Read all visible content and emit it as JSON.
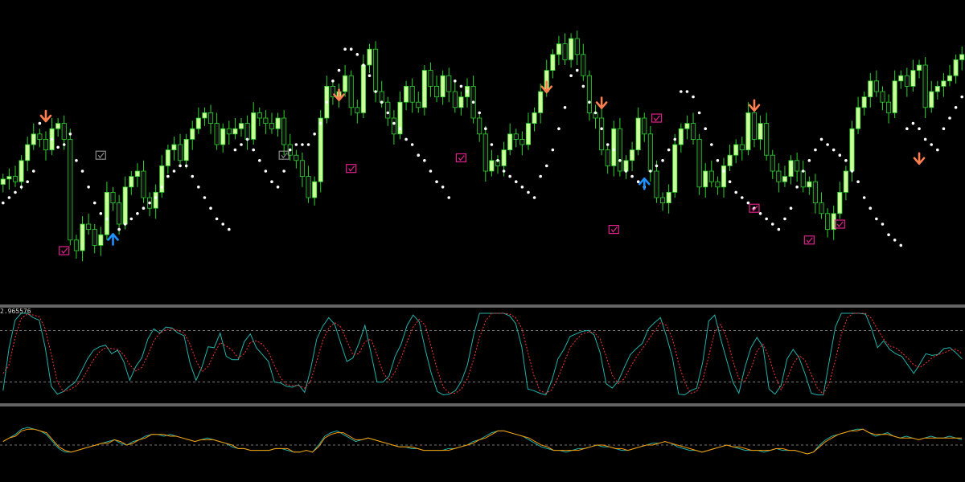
{
  "colors": {
    "background": "#000000",
    "bull_candle": "#ccff99",
    "bear_candle": "#111111",
    "candle_wick": "#2bd42b",
    "sar_dot": "#ffffff",
    "arrow_down": "#ff7f50",
    "arrow_up": "#1e90ff",
    "check_box_pink": "#e0208c",
    "check_box_gray": "#8a8a8a",
    "separator": "#c8c8c8",
    "level_line": "#9a9a9a",
    "stoch_main": "#20b2aa",
    "stoch_signal": "#ff3333",
    "osc_main": "#20b2aa",
    "osc_signal": "#ff9900"
  },
  "panel2_label": "2.965576",
  "chart_data": [
    {
      "type": "candlestick",
      "panel": "price",
      "ylim": [
        0,
        100
      ],
      "closes": [
        37,
        38,
        36,
        44,
        50,
        54,
        52,
        48,
        56,
        58,
        52,
        14,
        10,
        20,
        18,
        12,
        16,
        32,
        28,
        20,
        34,
        38,
        40,
        30,
        26,
        32,
        42,
        48,
        50,
        44,
        52,
        56,
        60,
        62,
        58,
        50,
        56,
        54,
        56,
        58,
        52,
        62,
        60,
        58,
        56,
        60,
        50,
        46,
        44,
        38,
        30,
        36,
        60,
        72,
        68,
        70,
        76,
        64,
        62,
        80,
        86,
        70,
        66,
        60,
        54,
        66,
        72,
        66,
        64,
        78,
        72,
        68,
        76,
        70,
        64,
        68,
        72,
        60,
        54,
        40,
        44,
        42,
        48,
        54,
        52,
        50,
        58,
        62,
        70,
        78,
        84,
        88,
        82,
        90,
        84,
        76,
        62,
        60,
        48,
        42,
        56,
        40,
        44,
        48,
        60,
        54,
        40,
        30,
        28,
        32,
        50,
        56,
        58,
        52,
        34,
        40,
        36,
        34,
        42,
        46,
        50,
        48,
        62,
        52,
        58,
        46,
        40,
        36,
        38,
        44,
        40,
        34,
        36,
        28,
        24,
        18,
        24,
        32,
        40,
        56,
        64,
        68,
        74,
        70,
        66,
        62,
        74,
        76,
        72,
        78,
        80,
        64,
        70,
        72,
        74,
        76,
        82,
        84
      ]
    },
    {
      "type": "scatter",
      "panel": "price",
      "name": "",
      "x": [
        0,
        1,
        2,
        3,
        4,
        5,
        6,
        8,
        9,
        10,
        11,
        12,
        13,
        14,
        15,
        16,
        17,
        18,
        19,
        20,
        21,
        22,
        23,
        24,
        25,
        26,
        27,
        28,
        29,
        30,
        31,
        32,
        33,
        34,
        35,
        36,
        37,
        38,
        39,
        40,
        41,
        42,
        43,
        44,
        45,
        46,
        47,
        48,
        49,
        50,
        51,
        52,
        53,
        54,
        55,
        56,
        57,
        58,
        59,
        60,
        61,
        62,
        63,
        64,
        65,
        66,
        67,
        68,
        69,
        70,
        71,
        72,
        73,
        74,
        75,
        76,
        77,
        78,
        79,
        80,
        81,
        82,
        83,
        84,
        85,
        86,
        87,
        88,
        89,
        90,
        91,
        92,
        93,
        94,
        95,
        96,
        97,
        98,
        99,
        100,
        101,
        102,
        103,
        104,
        105,
        106,
        107,
        108,
        109,
        110,
        111,
        112,
        113,
        114,
        115,
        116,
        117,
        118,
        119,
        120,
        121,
        122,
        123,
        124,
        125,
        126,
        127,
        128,
        129,
        130,
        131,
        132,
        133,
        134,
        135,
        136,
        137,
        138,
        139,
        140,
        141,
        142,
        143,
        144,
        145,
        146,
        147,
        148,
        149,
        150,
        151,
        152,
        153,
        154,
        155,
        156,
        157,
        158
      ],
      "values": [
        28,
        30,
        32,
        34,
        36,
        40,
        58,
        52,
        49,
        50,
        54,
        44,
        40,
        34,
        28,
        24,
        22,
        16,
        18,
        20,
        22,
        24,
        26,
        28,
        30,
        34,
        38,
        40,
        42,
        42,
        38,
        34,
        30,
        26,
        22,
        20,
        18,
        48,
        50,
        52,
        48,
        44,
        40,
        36,
        34,
        40,
        48,
        50,
        50,
        50,
        54,
        58,
        66,
        74,
        78,
        86,
        86,
        84,
        80,
        76,
        70,
        66,
        62,
        58,
        56,
        52,
        50,
        46,
        44,
        40,
        36,
        34,
        30,
        74,
        72,
        70,
        66,
        62,
        56,
        50,
        44,
        40,
        38,
        36,
        34,
        32,
        30,
        38,
        42,
        48,
        56,
        64,
        76,
        78,
        72,
        66,
        62,
        56,
        50,
        48,
        44,
        40,
        38,
        36,
        34,
        40,
        42,
        44,
        48,
        52,
        70,
        70,
        68,
        62,
        56,
        50,
        44,
        40,
        36,
        32,
        30,
        28,
        26,
        24,
        22,
        20,
        18,
        22,
        26,
        34,
        40,
        44,
        48,
        52,
        50,
        48,
        46,
        44,
        40,
        36,
        30,
        26,
        22,
        20,
        16,
        14,
        12,
        56,
        58,
        56,
        52,
        50,
        48,
        56,
        60,
        64,
        68,
        72,
        76,
        80
      ]
    },
    {
      "type": "markers",
      "panel": "price",
      "arrows_down": [
        [
          7,
          60
        ],
        [
          55,
          68
        ],
        [
          89,
          71
        ],
        [
          98,
          65
        ],
        [
          123,
          64
        ],
        [
          150,
          44
        ]
      ],
      "arrows_up": [
        [
          18,
          15
        ],
        [
          105,
          36
        ]
      ],
      "check_boxes_pink": [
        [
          10,
          10
        ],
        [
          57,
          41
        ],
        [
          75,
          45
        ],
        [
          100,
          18
        ],
        [
          107,
          60
        ],
        [
          123,
          26
        ],
        [
          137,
          20
        ],
        [
          132,
          14
        ]
      ],
      "check_boxes_gray": [
        [
          16,
          46
        ],
        [
          46,
          46
        ]
      ]
    },
    {
      "type": "line",
      "panel": "stochastic",
      "ylim": [
        0,
        100
      ],
      "levels": [
        80,
        20
      ],
      "series": [
        {
          "name": "",
          "values": [
            10,
            60,
            92,
            100,
            100,
            95,
            92,
            60,
            15,
            6,
            9,
            15,
            20,
            33,
            47,
            57,
            61,
            63,
            53,
            57,
            44,
            22,
            38,
            48,
            70,
            82,
            77,
            84,
            83,
            77,
            74,
            42,
            22,
            38,
            61,
            60,
            77,
            50,
            46,
            46,
            67,
            76,
            60,
            52,
            44,
            20,
            19,
            15,
            14,
            17,
            8,
            35,
            70,
            85,
            95,
            87,
            65,
            44,
            48,
            65,
            86,
            54,
            20,
            20,
            27,
            50,
            64,
            86,
            98,
            90,
            58,
            30,
            9,
            5,
            6,
            10,
            21,
            40,
            74,
            100,
            100,
            100,
            100,
            100,
            97,
            88,
            61,
            12,
            10,
            7,
            5,
            22,
            47,
            58,
            73,
            76,
            79,
            80,
            75,
            54,
            18,
            13,
            21,
            37,
            52,
            59,
            65,
            82,
            89,
            95,
            73,
            48,
            6,
            5,
            10,
            13,
            43,
            91,
            98,
            70,
            45,
            20,
            7,
            37,
            60,
            72,
            61,
            12,
            6,
            16,
            47,
            58,
            48,
            29,
            7,
            5,
            5,
            45,
            84,
            100,
            100,
            100,
            100,
            99,
            82,
            60,
            68,
            58,
            53,
            50,
            40,
            30,
            41,
            53,
            51,
            52,
            59,
            60,
            54,
            47
          ]
        },
        {
          "name": "",
          "values": [
            30,
            40,
            72,
            94,
            99,
            98,
            96,
            82,
            52,
            20,
            9,
            11,
            15,
            22,
            34,
            46,
            55,
            60,
            59,
            58,
            52,
            40,
            33,
            37,
            51,
            68,
            77,
            81,
            82,
            80,
            77,
            64,
            45,
            32,
            38,
            53,
            66,
            62,
            57,
            48,
            53,
            66,
            68,
            64,
            55,
            39,
            25,
            17,
            16,
            16,
            13,
            21,
            44,
            68,
            83,
            89,
            84,
            68,
            52,
            53,
            67,
            70,
            52,
            31,
            22,
            32,
            48,
            67,
            84,
            93,
            86,
            61,
            34,
            14,
            7,
            7,
            12,
            24,
            46,
            72,
            91,
            100,
            100,
            100,
            99,
            95,
            83,
            55,
            28,
            10,
            7,
            11,
            25,
            42,
            60,
            69,
            76,
            78,
            78,
            70,
            50,
            28,
            18,
            24,
            37,
            49,
            59,
            69,
            79,
            89,
            86,
            70,
            42,
            20,
            7,
            9,
            22,
            50,
            78,
            87,
            71,
            45,
            24,
            21,
            35,
            56,
            64,
            49,
            27,
            11,
            24,
            41,
            51,
            45,
            29,
            13,
            6,
            19,
            45,
            76,
            95,
            100,
            100,
            100,
            94,
            81,
            70,
            62,
            60,
            54,
            48,
            40,
            37,
            42,
            48,
            52,
            54,
            57,
            58,
            53
          ]
        }
      ]
    },
    {
      "type": "line",
      "panel": "oscillator",
      "ylim": [
        -2,
        2
      ],
      "levels": [
        0
      ],
      "series": [
        {
          "name": "",
          "values": [
            0.2,
            0.4,
            0.6,
            0.9,
            1.0,
            0.9,
            0.8,
            0.6,
            0.2,
            -0.2,
            -0.4,
            -0.4,
            -0.3,
            -0.2,
            -0.1,
            0.0,
            0.1,
            0.2,
            0.3,
            0.1,
            0.0,
            0.2,
            0.3,
            0.5,
            0.6,
            0.6,
            0.5,
            0.6,
            0.5,
            0.4,
            0.3,
            0.2,
            0.3,
            0.4,
            0.3,
            0.2,
            0.1,
            -0.1,
            -0.2,
            -0.2,
            -0.3,
            -0.3,
            -0.3,
            -0.3,
            -0.2,
            -0.2,
            -0.3,
            -0.4,
            -0.4,
            -0.3,
            -0.4,
            0.0,
            0.5,
            0.7,
            0.8,
            0.6,
            0.4,
            0.2,
            0.3,
            0.4,
            0.3,
            0.2,
            0.1,
            0.0,
            -0.1,
            -0.1,
            -0.2,
            -0.2,
            -0.3,
            -0.3,
            -0.3,
            -0.3,
            -0.2,
            -0.2,
            -0.1,
            0.0,
            0.2,
            0.3,
            0.5,
            0.7,
            0.8,
            0.8,
            0.7,
            0.6,
            0.5,
            0.3,
            0.1,
            -0.1,
            -0.2,
            -0.3,
            -0.3,
            -0.4,
            -0.3,
            -0.2,
            -0.2,
            -0.1,
            0.0,
            -0.1,
            -0.1,
            -0.2,
            -0.3,
            -0.3,
            -0.2,
            -0.1,
            0.0,
            0.1,
            0.1,
            0.2,
            0.1,
            -0.1,
            -0.2,
            -0.3,
            -0.3,
            -0.4,
            -0.3,
            -0.2,
            -0.1,
            0.0,
            -0.1,
            -0.2,
            -0.3,
            -0.3,
            -0.3,
            -0.4,
            -0.3,
            -0.2,
            -0.3,
            -0.3,
            -0.3,
            -0.4,
            -0.5,
            -0.4,
            0.0,
            0.3,
            0.5,
            0.6,
            0.7,
            0.8,
            0.9,
            0.9,
            0.7,
            0.5,
            0.6,
            0.7,
            0.5,
            0.4,
            0.5,
            0.4,
            0.3,
            0.4,
            0.5,
            0.4,
            0.4,
            0.5,
            0.4,
            0.3
          ]
        },
        {
          "name": "",
          "values": [
            0.2,
            0.4,
            0.5,
            0.8,
            0.9,
            0.9,
            0.8,
            0.7,
            0.3,
            -0.1,
            -0.3,
            -0.4,
            -0.3,
            -0.2,
            -0.1,
            0.0,
            0.1,
            0.1,
            0.3,
            0.2,
            0.0,
            0.1,
            0.3,
            0.4,
            0.6,
            0.6,
            0.6,
            0.5,
            0.5,
            0.4,
            0.3,
            0.2,
            0.3,
            0.3,
            0.3,
            0.2,
            0.1,
            0.0,
            -0.2,
            -0.2,
            -0.3,
            -0.3,
            -0.3,
            -0.3,
            -0.2,
            -0.2,
            -0.2,
            -0.4,
            -0.4,
            -0.3,
            -0.4,
            -0.1,
            0.4,
            0.6,
            0.7,
            0.7,
            0.5,
            0.3,
            0.3,
            0.4,
            0.3,
            0.2,
            0.1,
            0.0,
            -0.1,
            -0.1,
            -0.1,
            -0.2,
            -0.3,
            -0.3,
            -0.3,
            -0.3,
            -0.3,
            -0.2,
            -0.1,
            0.0,
            0.1,
            0.3,
            0.4,
            0.6,
            0.8,
            0.8,
            0.7,
            0.6,
            0.5,
            0.4,
            0.2,
            0.0,
            -0.1,
            -0.3,
            -0.3,
            -0.3,
            -0.3,
            -0.3,
            -0.2,
            -0.1,
            0.0,
            0.0,
            -0.1,
            -0.2,
            -0.2,
            -0.3,
            -0.2,
            -0.1,
            0.0,
            0.0,
            0.1,
            0.2,
            0.1,
            0.0,
            -0.1,
            -0.2,
            -0.3,
            -0.4,
            -0.3,
            -0.2,
            -0.1,
            0.0,
            -0.1,
            -0.1,
            -0.2,
            -0.3,
            -0.3,
            -0.3,
            -0.3,
            -0.2,
            -0.2,
            -0.3,
            -0.3,
            -0.4,
            -0.5,
            -0.4,
            -0.1,
            0.2,
            0.4,
            0.6,
            0.7,
            0.8,
            0.8,
            0.9,
            0.7,
            0.6,
            0.6,
            0.6,
            0.5,
            0.4,
            0.4,
            0.4,
            0.3,
            0.4,
            0.4,
            0.4,
            0.4,
            0.4,
            0.4,
            0.4
          ]
        }
      ]
    }
  ]
}
